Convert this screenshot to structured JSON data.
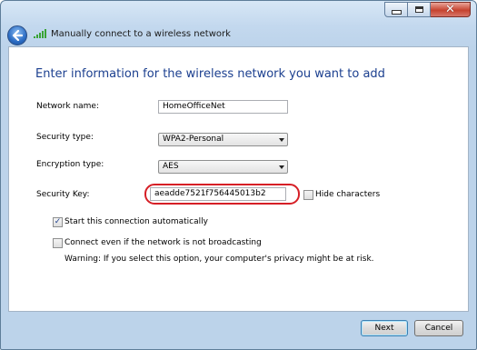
{
  "window": {
    "title": "Manually connect to a wireless network",
    "close_glyph": "✕"
  },
  "icons": {
    "back": "back-arrow-icon",
    "signal": "wireless-signal-icon",
    "minimize": "minimize-icon",
    "maximize": "maximize-icon",
    "close": "close-icon",
    "checkmark": "✓"
  },
  "content": {
    "heading": "Enter information for the wireless network you want to add",
    "network_name": {
      "label": "Network name:",
      "value": "HomeOfficeNet"
    },
    "security_type": {
      "label": "Security type:",
      "value": "WPA2-Personal"
    },
    "encryption_type": {
      "label": "Encryption type:",
      "value": "AES"
    },
    "security_key": {
      "label": "Security Key:",
      "value": "aeadde7521f756445013b2"
    },
    "hide_characters": {
      "label": "Hide characters",
      "checked": false
    },
    "start_auto": {
      "label": "Start this connection automatically",
      "checked": true
    },
    "connect_even": {
      "label": "Connect even if the network is not broadcasting",
      "checked": false
    },
    "warning": "Warning: If you select this option, your computer's privacy might be at risk."
  },
  "buttons": {
    "next": "Next",
    "cancel": "Cancel"
  },
  "colors": {
    "heading": "#1b3f8f",
    "highlight_ring": "#d61f26",
    "close_button": "#c6432f"
  }
}
